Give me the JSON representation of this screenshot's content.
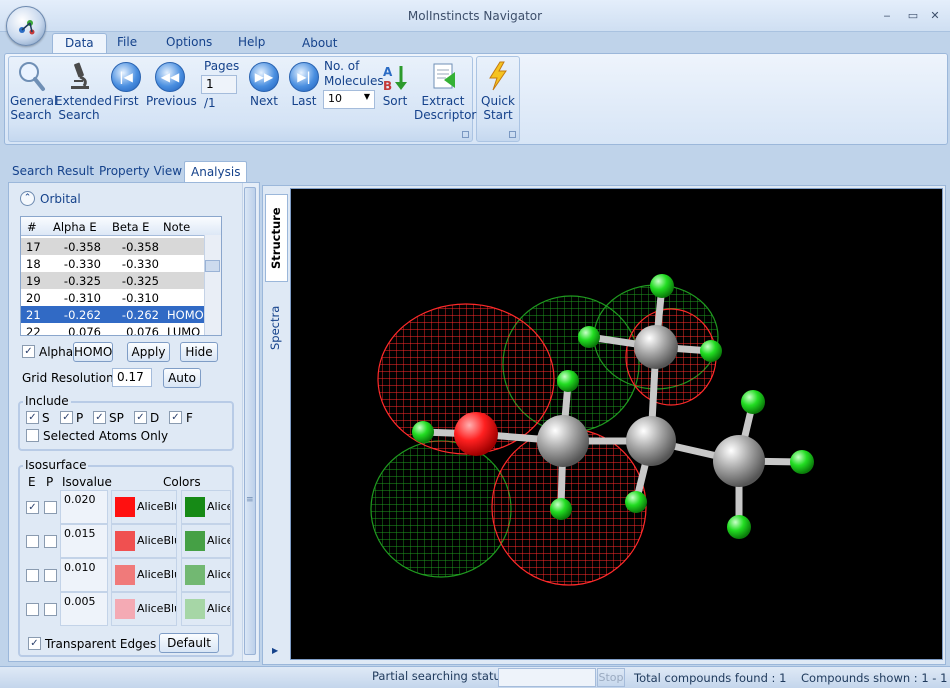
{
  "window": {
    "title": "MolInstincts Navigator",
    "minimize": "‒",
    "maximize": "▭",
    "close": "✕"
  },
  "ribbon_tabs": [
    "Data",
    "File",
    "Options",
    "Help",
    "About"
  ],
  "ribbon": {
    "general_search": [
      "General",
      "Search"
    ],
    "extended_search": [
      "Extended",
      "Search"
    ],
    "first": "First",
    "previous": "Previous",
    "pages_label": "Pages",
    "page_value": "1",
    "page_total": "/1",
    "next": "Next",
    "last": "Last",
    "molecules_label": [
      "No. of",
      "Molecules"
    ],
    "molecules_value": "10",
    "sort": "Sort",
    "extract_descriptor": [
      "Extract",
      "Descriptor"
    ],
    "quick_start": [
      "Quick",
      "Start"
    ]
  },
  "panel_tabs": [
    "Search Result",
    "Property View",
    "Analysis"
  ],
  "viewer_tabs": [
    "Structure",
    "Spectra"
  ],
  "orbital": {
    "section_title": "Orbital",
    "columns": [
      "#",
      "Alpha E",
      "Beta E",
      "Note"
    ],
    "rows": [
      {
        "n": "17",
        "alpha": "-0.358",
        "beta": "-0.358",
        "note": ""
      },
      {
        "n": "18",
        "alpha": "-0.330",
        "beta": "-0.330",
        "note": ""
      },
      {
        "n": "19",
        "alpha": "-0.325",
        "beta": "-0.325",
        "note": ""
      },
      {
        "n": "20",
        "alpha": "-0.310",
        "beta": "-0.310",
        "note": ""
      },
      {
        "n": "21",
        "alpha": "-0.262",
        "beta": "-0.262",
        "note": "HOMO"
      },
      {
        "n": "22",
        "alpha": "0.076",
        "beta": "0.076",
        "note": "LUMO"
      }
    ],
    "alpha_label": "Alpha",
    "homo_button": "HOMO",
    "apply_button": "Apply",
    "hide_button": "Hide",
    "grid_resolution_label": "Grid Resolution",
    "grid_resolution_value": "0.17",
    "auto_button": "Auto"
  },
  "include": {
    "title": "Include",
    "items": [
      "S",
      "P",
      "SP",
      "D",
      "F"
    ],
    "selected_atoms_only": "Selected Atoms Only"
  },
  "isosurface": {
    "title": "Isosurface",
    "col_e": "E",
    "col_p": "P",
    "col_isovalue": "Isovalue",
    "col_colors": "Colors",
    "rows": [
      {
        "isovalue": "0.020",
        "neg_label": "AliceBlu",
        "pos_label": "Alice",
        "neg_color": "#ff1010",
        "pos_color": "#168a16",
        "e_checked": true
      },
      {
        "isovalue": "0.015",
        "neg_label": "AliceBlu",
        "pos_label": "Alice",
        "neg_color": "#f05050",
        "pos_color": "#45a045",
        "e_checked": false
      },
      {
        "isovalue": "0.010",
        "neg_label": "AliceBlu",
        "pos_label": "Alice",
        "neg_color": "#f07a7a",
        "pos_color": "#72b872",
        "e_checked": false
      },
      {
        "isovalue": "0.005",
        "neg_label": "AliceBlu",
        "pos_label": "Alice",
        "neg_color": "#f4aab4",
        "pos_color": "#a6d6a6",
        "e_checked": false
      }
    ],
    "transparent_edges": "Transparent Edges",
    "default_button": "Default"
  },
  "statusbar": {
    "partial_status": "Partial searching status :",
    "stop": "Stop",
    "total_found": "Total compounds found : 1",
    "shown": "Compounds shown : 1 - 1"
  },
  "colors": {
    "accent": "#15428b",
    "selected_row": "#316ac5",
    "negative_lobe": "#ff2020",
    "positive_lobe": "#1f9a1f",
    "hydrogen": "#22dd22",
    "carbon": "#a8a8a8",
    "oxygen": "#ff2020"
  }
}
